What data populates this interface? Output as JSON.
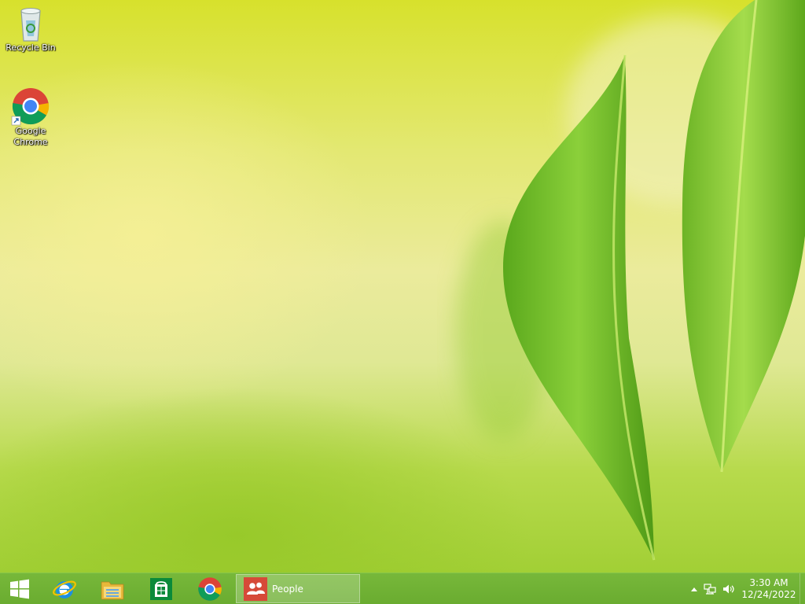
{
  "desktop": {
    "icons": [
      {
        "label": "Recycle Bin",
        "icon": "recycle-bin-icon"
      },
      {
        "label": "Google\nChrome",
        "icon": "chrome-icon"
      }
    ]
  },
  "taskbar": {
    "start_icon": "windows-logo-icon",
    "pinned": [
      {
        "icon": "internet-explorer-icon"
      },
      {
        "icon": "file-explorer-icon"
      },
      {
        "icon": "store-icon"
      },
      {
        "icon": "chrome-icon"
      }
    ],
    "running_app": {
      "label": "People",
      "icon": "people-icon",
      "accent": "#d64a38"
    },
    "tray": {
      "icons": [
        "chevron-up-icon",
        "network-icon",
        "volume-icon"
      ],
      "time": "3:30 AM",
      "date": "12/24/2022"
    }
  },
  "colors": {
    "taskbar": "#6fb034",
    "wallpaper_top": "#d7e12c",
    "wallpaper_bottom": "#9bcc2e"
  }
}
